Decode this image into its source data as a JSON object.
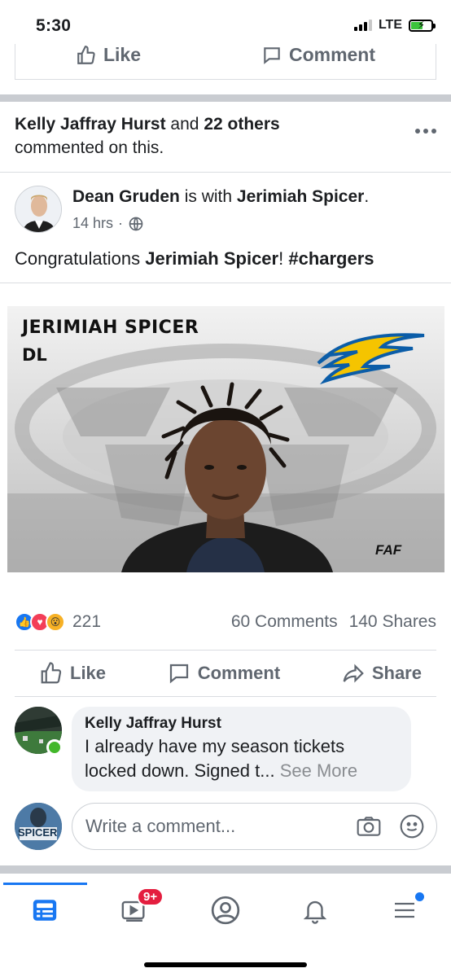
{
  "status_bar": {
    "time": "5:30",
    "network": "LTE"
  },
  "previous_post": {
    "like_label": "Like",
    "comment_label": "Comment"
  },
  "activity": {
    "actor": "Kelly Jaffray Hurst",
    "joiner": "and",
    "others": "22 others",
    "suffix": "commented on this."
  },
  "post": {
    "author": "Dean Gruden",
    "with_text": "is with",
    "tagged": "Jerimiah Spicer",
    "time": "14 hrs",
    "privacy_icon": "globe-icon",
    "text_before": "Congratulations",
    "text_name": "Jerimiah Spicer",
    "text_after": "! ",
    "hashtag": "#chargers",
    "image": {
      "player_name": "JERIMIAH SPICER",
      "position": "DL",
      "watermark": "FAF"
    }
  },
  "stats": {
    "reactions_count": "221",
    "comments": "60 Comments",
    "shares": "140 Shares"
  },
  "actions": {
    "like": "Like",
    "comment": "Comment",
    "share": "Share"
  },
  "comment": {
    "author": "Kelly Jaffray Hurst",
    "line1": "I already have my season tickets",
    "line2": "locked down. Signed t...",
    "see_more": "See More"
  },
  "composer": {
    "avatar_text": "SPICER",
    "placeholder": "Write a comment..."
  },
  "bottom_nav": {
    "badge": "9+"
  },
  "colors": {
    "accent": "#1877f2",
    "badge": "#e41e3f",
    "online": "#42b72a",
    "chargers_blue": "#0b5da8",
    "chargers_gold": "#f5c400"
  }
}
